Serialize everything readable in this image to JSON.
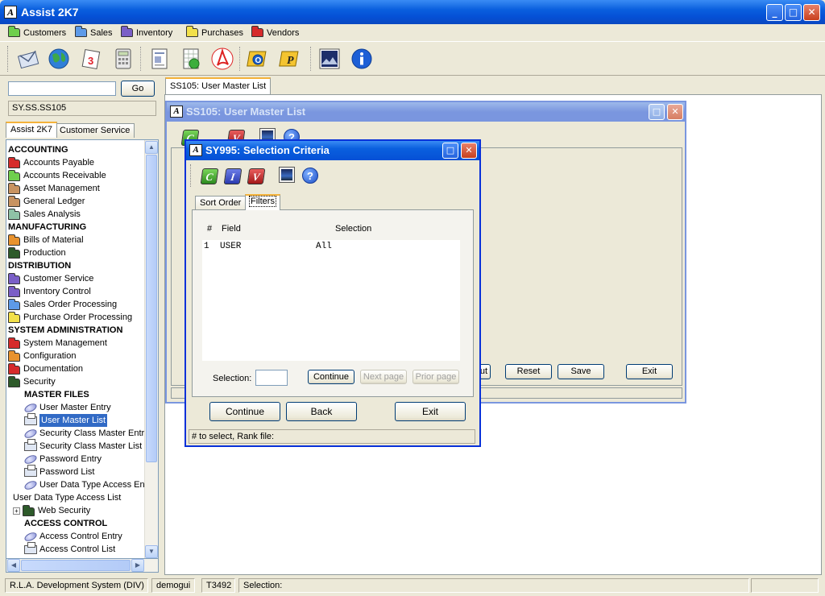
{
  "app": {
    "title": "Assist 2K7",
    "logo_letter": "A"
  },
  "window_controls": {
    "minimize": "_",
    "maximize": "□",
    "close": "✕"
  },
  "menu": [
    {
      "label": "Customers",
      "icon": "folder-green-icon"
    },
    {
      "label": "Sales",
      "icon": "folder-blue-icon"
    },
    {
      "label": "Inventory",
      "icon": "folder-purple-icon"
    },
    {
      "label": "Purchases",
      "icon": "folder-yellow-icon"
    },
    {
      "label": "Vendors",
      "icon": "folder-red-icon"
    }
  ],
  "toolbar_icons": [
    "email-icon",
    "globe-icon",
    "calendar-icon",
    "calculator-icon",
    "document-icon",
    "spreadsheet-icon",
    "acrobat-icon",
    "outlook-icon",
    "p-icon",
    "image-icon",
    "info-icon"
  ],
  "left_panel": {
    "search": {
      "value": "",
      "go_label": "Go"
    },
    "path": "SY.SS.SS105",
    "tabs": [
      "Assist 2K7",
      "Customer Service"
    ],
    "tree": [
      {
        "label": "ACCOUNTING",
        "type": "heading",
        "indent": 0
      },
      {
        "label": "Accounts Payable",
        "type": "folder",
        "color": "red",
        "indent": 0
      },
      {
        "label": "Accounts Receivable",
        "type": "folder",
        "color": "green",
        "indent": 0
      },
      {
        "label": "Asset Management",
        "type": "folder",
        "color": "brown",
        "indent": 0
      },
      {
        "label": "General Ledger",
        "type": "folder",
        "color": "brown",
        "indent": 0
      },
      {
        "label": "Sales Analysis",
        "type": "folder",
        "color": "teal",
        "indent": 0
      },
      {
        "label": "MANUFACTURING",
        "type": "heading",
        "indent": 0
      },
      {
        "label": "Bills of Material",
        "type": "folder",
        "color": "orange",
        "indent": 0
      },
      {
        "label": "Production",
        "type": "folder",
        "color": "dark",
        "indent": 0
      },
      {
        "label": "DISTRIBUTION",
        "type": "heading",
        "indent": 0
      },
      {
        "label": "Customer Service",
        "type": "folder",
        "color": "purple",
        "indent": 0
      },
      {
        "label": "Inventory Control",
        "type": "folder",
        "color": "purple",
        "indent": 0
      },
      {
        "label": "Sales Order Processing",
        "type": "folder",
        "color": "blue",
        "indent": 0
      },
      {
        "label": "Purchase Order Processing",
        "type": "folder",
        "color": "yellow",
        "indent": 0
      },
      {
        "label": "SYSTEM ADMINISTRATION",
        "type": "heading",
        "indent": 0
      },
      {
        "label": "System Management",
        "type": "folder",
        "color": "red",
        "indent": 0
      },
      {
        "label": "Configuration",
        "type": "folder",
        "color": "orange",
        "indent": 0
      },
      {
        "label": "Documentation",
        "type": "folder",
        "color": "red",
        "indent": 0
      },
      {
        "label": "Security",
        "type": "folder",
        "color": "dark",
        "indent": 0
      },
      {
        "label": "MASTER FILES",
        "type": "heading",
        "indent": 2
      },
      {
        "label": "User Master Entry",
        "type": "entry",
        "indent": 2
      },
      {
        "label": "User Master List",
        "type": "printer",
        "indent": 2,
        "selected": true
      },
      {
        "label": "Security Class Master Entry",
        "type": "entry",
        "indent": 2
      },
      {
        "label": "Security Class Master List",
        "type": "printer",
        "indent": 2
      },
      {
        "label": "Password Entry",
        "type": "entry",
        "indent": 2
      },
      {
        "label": "Password List",
        "type": "printer",
        "indent": 2
      },
      {
        "label": "User Data Type Access Ent",
        "type": "entry",
        "indent": 2
      },
      {
        "label": "User Data Type Access List",
        "type": "plain",
        "indent": 1
      },
      {
        "label": "Web Security",
        "type": "folder",
        "color": "dark",
        "indent": 2,
        "expander": "+"
      },
      {
        "label": "ACCESS CONTROL",
        "type": "heading",
        "indent": 2
      },
      {
        "label": "Access Control Entry",
        "type": "entry",
        "indent": 2
      },
      {
        "label": "Access Control List",
        "type": "printer",
        "indent": 2
      }
    ]
  },
  "workspace": {
    "tab_label": "SS105: User Master List",
    "back_window": {
      "title": "SS105: User Master List",
      "buttons": {
        "partial": "ut",
        "reset": "Reset",
        "save": "Save",
        "exit": "Exit"
      }
    },
    "dialog": {
      "title": "SY995: Selection Criteria",
      "tool_letters": {
        "c": "C",
        "i": "I",
        "v": "V",
        "help": "?"
      },
      "tabs": [
        "Sort Order",
        "Filters"
      ],
      "columns": {
        "num": "#",
        "field": "Field",
        "selection": "Selection"
      },
      "rows": [
        {
          "num": "1",
          "field": "USER",
          "selection": "All"
        }
      ],
      "selection_label": "Selection:",
      "selection_value": "",
      "inner_buttons": {
        "continue": "Continue",
        "next_page": "Next page",
        "prior_page": "Prior page"
      },
      "buttons": {
        "continue": "Continue",
        "back": "Back",
        "exit": "Exit"
      },
      "status": "# to select,  Rank file:"
    }
  },
  "status_bar": {
    "system": "R.L.A. Development System (DIV)",
    "user": "demogui",
    "terminal": "T3492",
    "message": "Selection:"
  }
}
